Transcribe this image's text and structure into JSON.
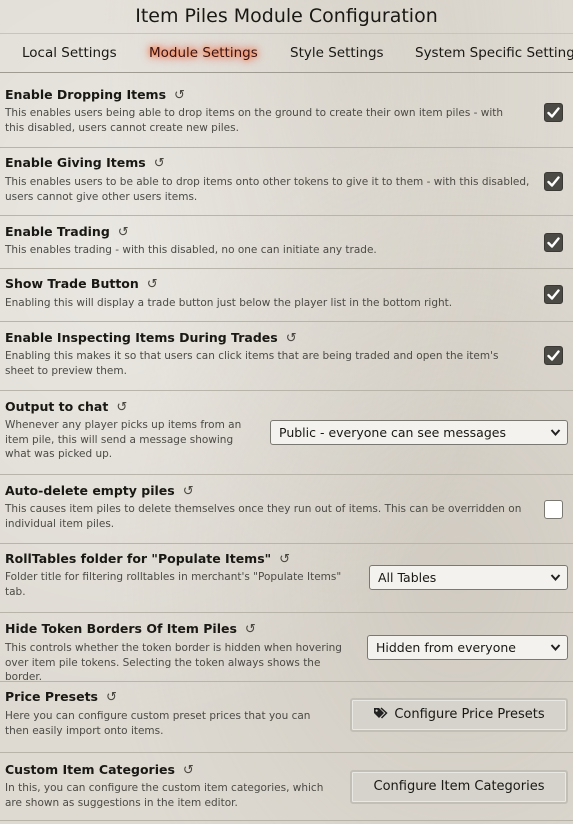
{
  "window": {
    "title": "Item Piles Module Configuration"
  },
  "tabs": [
    {
      "label": "Local Settings",
      "active": false
    },
    {
      "label": "Module Settings",
      "active": true
    },
    {
      "label": "Style Settings",
      "active": false
    },
    {
      "label": "System Specific Settings",
      "active": false
    }
  ],
  "settings": {
    "enable_dropping": {
      "label": "Enable Dropping Items",
      "hint": "This enables users being able to drop items on the ground to create their own item piles - with this disabled, users cannot create new piles.",
      "checked": true
    },
    "enable_giving": {
      "label": "Enable Giving Items",
      "hint": "This enables users to be able to drop items onto other tokens to give it to them - with this disabled, users cannot give other users items.",
      "checked": true
    },
    "enable_trading": {
      "label": "Enable Trading",
      "hint": "This enables trading - with this disabled, no one can initiate any trade.",
      "checked": true
    },
    "show_trade_button": {
      "label": "Show Trade Button",
      "hint": "Enabling this will display a trade button just below the player list in the bottom right.",
      "checked": true
    },
    "inspecting_items": {
      "label": "Enable Inspecting Items During Trades",
      "hint": "Enabling this makes it so that users can click items that are being traded and open the item's sheet to preview them.",
      "checked": true
    },
    "output_to_chat": {
      "label": "Output to chat",
      "hint": "Whenever any player picks up items from an item pile, this will send a message showing what was picked up.",
      "value": "Public - everyone can see messages"
    },
    "auto_delete": {
      "label": "Auto-delete empty piles",
      "hint": "This causes item piles to delete themselves once they run out of items. This can be overridden on individual item piles.",
      "checked": false
    },
    "rolltables_folder": {
      "label": "RollTables folder for \"Populate Items\"",
      "hint": "Folder title for filtering rolltables in merchant's \"Populate Items\" tab.",
      "value": "All Tables"
    },
    "hide_token_borders": {
      "label": "Hide Token Borders Of Item Piles",
      "hint": "This controls whether the token border is hidden when hovering over item pile tokens. Selecting the token always shows the border.",
      "value": "Hidden from everyone"
    },
    "price_presets": {
      "label": "Price Presets",
      "hint": "Here you can configure custom preset prices that you can then easily import onto items.",
      "button": "Configure Price Presets",
      "icon": "tags-icon"
    },
    "item_categories": {
      "label": "Custom Item Categories",
      "hint": "In this, you can configure the custom item categories, which are shown as suggestions in the item editor.",
      "button": "Configure Item Categories"
    }
  },
  "icons": {
    "reset": "reset-icon",
    "checkbox": "checkmark-icon",
    "dropdown": "chevron-down-icon"
  },
  "colors": {
    "active_tab_glow": "#ff6400",
    "checkbox_fill": "#4b4a44"
  }
}
